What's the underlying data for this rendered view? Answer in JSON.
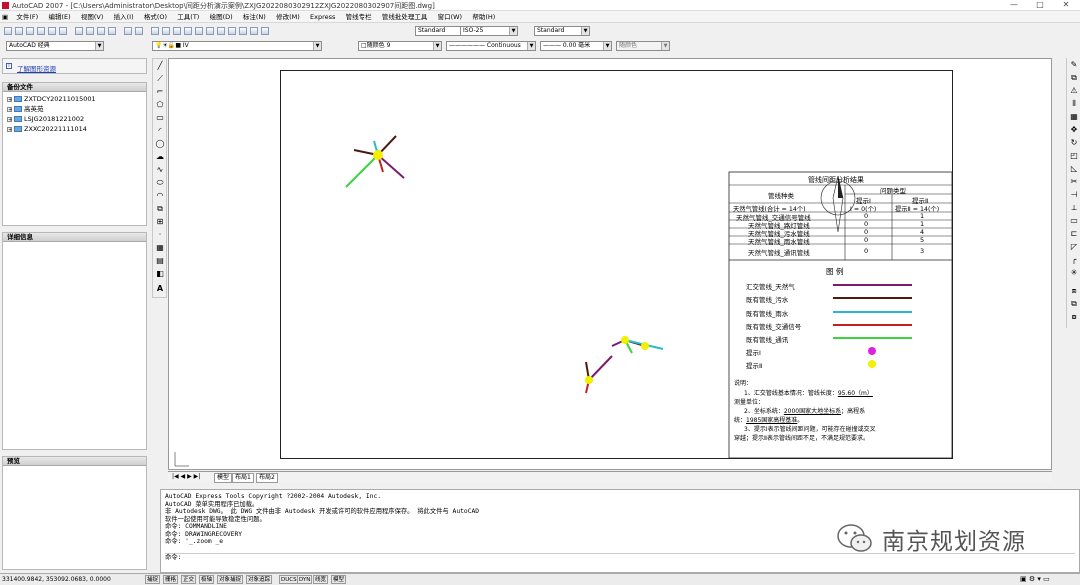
{
  "titlebar": {
    "title": "AutoCAD 2007 - [C:\\Users\\Administrator\\Desktop\\间距分析演示案例\\ZXJG2022080302912ZXJG2022080302907间距图.dwg]",
    "min": "—",
    "max": "□",
    "close": "✕"
  },
  "menu": [
    "文件(F)",
    "编辑(E)",
    "视图(V)",
    "插入(I)",
    "格式(O)",
    "工具(T)",
    "绘图(D)",
    "标注(N)",
    "修改(M)",
    "Express",
    "管线专栏",
    "管线批处理工具",
    "窗口(W)",
    "帮助(H)"
  ],
  "toolbar": {
    "workspace": "AutoCAD 经典",
    "layer": "IV",
    "text_style": "Standard",
    "dim_style": "ISO-25",
    "table_style": "Standard",
    "color": "□随颜色 9",
    "linetype": "—————— Continuous",
    "lineweight": "——— 0.00 毫米",
    "plotstyle": "随颜色"
  },
  "left_panel": {
    "link": "了解图形资源",
    "backup_title": "备份文件",
    "backup_items": [
      "ZXTDCY20211015001",
      "高英苑",
      "LSJG20181221002",
      "ZXXC20221111014"
    ],
    "detail_title": "详细信息",
    "preview_title": "预览"
  },
  "tabs": [
    "模型",
    "布局1",
    "布局2"
  ],
  "result_table": {
    "title": "管线间距分析结果",
    "col_type": "管线种类",
    "col_group": "问题类型",
    "col_a": "提示Ⅰ",
    "col_b": "提示Ⅱ",
    "total": "天然气管线(合计 = 14个)",
    "total_a": "Ⅰ = 0(个)",
    "total_b": "提示Ⅱ = 14(个)",
    "rows": [
      {
        "name": "天然气管线_交通信号管线",
        "a": "0",
        "b": "1"
      },
      {
        "name": "天然气管线_路灯管线",
        "a": "0",
        "b": "1"
      },
      {
        "name": "天然气管线_污水管线",
        "a": "0",
        "b": "4"
      },
      {
        "name": "天然气管线_雨水管线",
        "a": "0",
        "b": "5"
      },
      {
        "name": "天然气管线_通讯管线",
        "a": "0",
        "b": "3"
      }
    ]
  },
  "legend": {
    "title": "图    例",
    "items": [
      {
        "label": "汇交管线_天然气",
        "color": "#7b1b6e"
      },
      {
        "label": "既有管线_污水",
        "color": "#4a1c10"
      },
      {
        "label": "既有管线_雨水",
        "color": "#2ab8d0"
      },
      {
        "label": "既有管线_交通信号",
        "color": "#c42020"
      },
      {
        "label": "既有管线_通讯",
        "color": "#3fd23f"
      }
    ],
    "dot_a": "提示Ⅰ",
    "dot_a_color": "#e020e0",
    "dot_b": "提示Ⅱ",
    "dot_b_color": "#f0f000"
  },
  "notes": {
    "head": "说明：",
    "l1": "1、汇交管线基本情况：管线长度：",
    "l1v": "95.60（m）",
    "l2": "测量单位：",
    "l3": "2、坐标系统：",
    "l3v": "2000国家大地坐标系",
    "l3b": "；高程系",
    "l4": "统：",
    "l4v": "1985国家高程基准",
    "l4e": "。",
    "l5": "3、提示Ⅰ表示管线间距问题，可能存在碰撞或交叉",
    "l6": "穿越；提示Ⅱ表示管线间距不足，不满足规范要求。"
  },
  "command": [
    "AutoCAD Express Tools Copyright ?2002-2004 Autodesk, Inc.",
    "AutoCAD 菜单实用程序已加载。",
    "非 Autodesk DWG。  此 DWG 文件由非 Autodesk 开发或许可的软件应用程序保存。  将此文件与 AutoCAD",
    "软件一起使用可能导致稳定性问题。",
    "命令: COMMANDLINE",
    "命令: DRAWINGRECOVERY",
    "命令: '_.zoom _e",
    "",
    "命令:"
  ],
  "status": {
    "coords": "331400.9842, 353092.0683, 0.0000",
    "buttons": [
      "捕捉",
      "栅格",
      "正交",
      "极轴",
      "对象捕捉",
      "对象追踪",
      "DUCS",
      "DYN",
      "线宽",
      "模型"
    ]
  },
  "watermark": "南京规划资源"
}
